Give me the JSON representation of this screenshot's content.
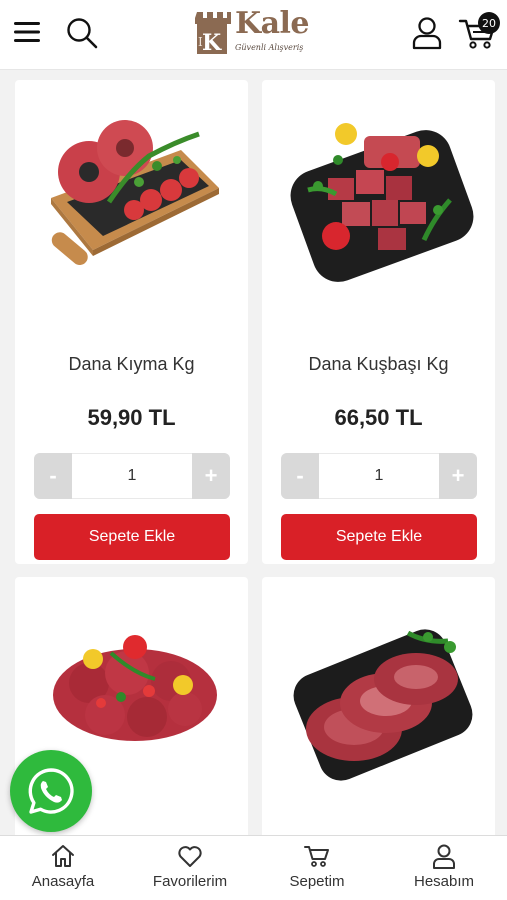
{
  "header": {
    "logo_name": "Kale",
    "logo_slogan": "Güvenli Alışveriş",
    "cart_count": "20",
    "icons": [
      "menu-icon",
      "search-icon",
      "user-icon",
      "cart-icon"
    ]
  },
  "products": [
    {
      "name": "Dana Kıyma Kg",
      "price": "59,90 TL",
      "quantity": "1",
      "minus": "-",
      "plus": "+",
      "add_label": "Sepete Ekle",
      "image": "minced-beef-on-board"
    },
    {
      "name": "Dana Kuşbaşı Kg",
      "price": "66,50 TL",
      "quantity": "1",
      "minus": "-",
      "plus": "+",
      "add_label": "Sepete Ekle",
      "image": "diced-beef-on-plate"
    },
    {
      "image": "beef-medallions"
    },
    {
      "image": "sliced-ribeye-on-tray"
    }
  ],
  "bottom_nav": [
    {
      "label": "Anasayfa",
      "icon": "home-icon"
    },
    {
      "label": "Favorilerim",
      "icon": "heart-icon"
    },
    {
      "label": "Sepetim",
      "icon": "cart-icon"
    },
    {
      "label": "Hesabım",
      "icon": "user-icon"
    }
  ],
  "colors": {
    "accent_red": "#d92027",
    "whatsapp_green": "#2fba3d",
    "logo_brown": "#8b6a52"
  }
}
